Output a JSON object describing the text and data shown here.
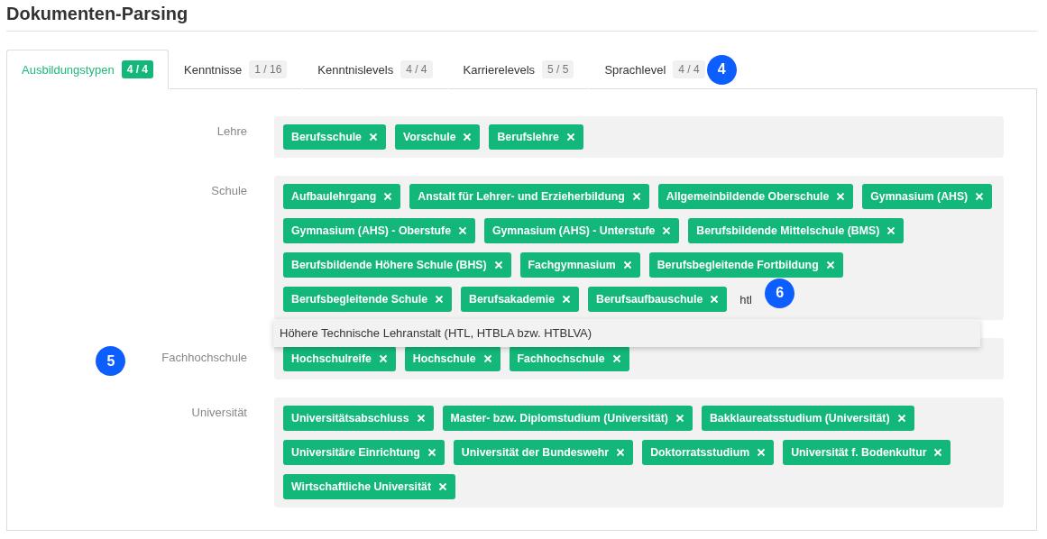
{
  "title": "Dokumenten-Parsing",
  "tabs": [
    {
      "label": "Ausbildungstypen",
      "count": "4 / 4",
      "selected": true
    },
    {
      "label": "Kenntnisse",
      "count": "1 / 16",
      "selected": false
    },
    {
      "label": "Kenntnislevels",
      "count": "4 / 4",
      "selected": false
    },
    {
      "label": "Karrierelevels",
      "count": "5 / 5",
      "selected": false
    },
    {
      "label": "Sprachlevel",
      "count": "4 / 4",
      "selected": false,
      "callout": "4"
    }
  ],
  "sections": [
    {
      "label": "Lehre",
      "tags": [
        "Berufsschule",
        "Vorschule",
        "Berufslehre"
      ]
    },
    {
      "label": "Schule",
      "tags": [
        "Aufbaulehrgang",
        "Anstalt für Lehrer- und Erzieherbildung",
        "Allgemeinbildende Oberschule",
        "Gymnasium (AHS)",
        "Gymnasium (AHS) - Oberstufe",
        "Gymnasium (AHS) - Unterstufe",
        "Berufsbildende Mittelschule (BMS)",
        "Berufsbildende Höhere Schule (BHS)",
        "Fachgymnasium",
        "Berufsbegleitende Fortbildung",
        "Berufsbegleitende Schule",
        "Berufsakademie",
        "Berufsaufbauschule"
      ],
      "input": "htl",
      "input_callout": "6",
      "suggestions": [
        "Höhere Technische Lehranstalt (HTL, HTBLA bzw. HTBLVA)"
      ]
    },
    {
      "label": "Fachhochschule",
      "callout": "5",
      "tags": [
        "Hochschulreife",
        "Hochschule",
        "Fachhochschule"
      ]
    },
    {
      "label": "Universität",
      "tags": [
        "Universitätsabschluss",
        "Master- bzw. Diplomstudium (Universität)",
        "Bakklaureatsstudium (Universität)",
        "Universitäre Einrichtung",
        "Universität der Bundeswehr",
        "Doktorratsstudium",
        "Universität f. Bodenkultur",
        "Wirtschaftliche Universität"
      ]
    }
  ]
}
